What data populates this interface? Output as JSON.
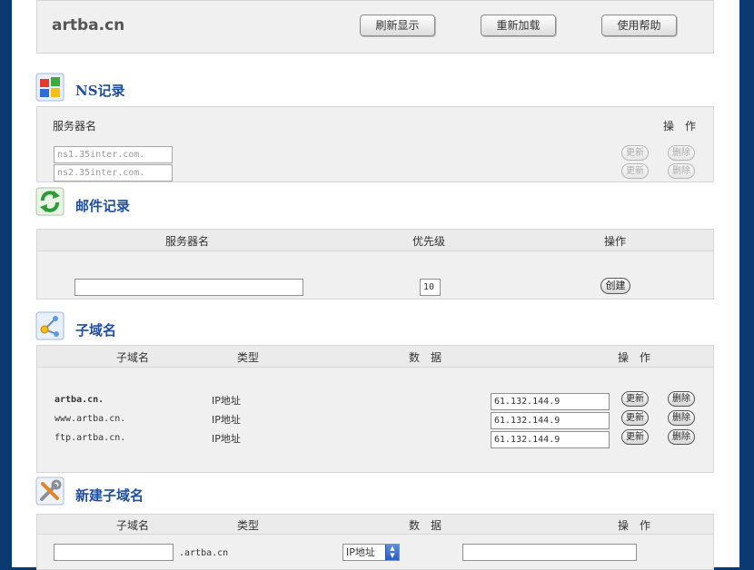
{
  "header": {
    "domain": "artba.cn",
    "refresh_label": "刷新显示",
    "reload_label": "重新加载",
    "help_label": "使用帮助"
  },
  "ns": {
    "title": "NS记录",
    "col_server": "服务器名",
    "col_action": "操　作",
    "rows": [
      {
        "value": "ns1.35inter.com.",
        "update": "更新",
        "delete": "删除"
      },
      {
        "value": "ns2.35inter.com.",
        "update": "更新",
        "delete": "删除"
      }
    ]
  },
  "mail": {
    "title": "邮件记录",
    "col_server": "服务器名",
    "col_priority": "优先级",
    "col_action": "操作",
    "server_value": "",
    "priority_value": "10",
    "create_label": "创建"
  },
  "subdomain": {
    "title": "子域名",
    "col_name": "子域名",
    "col_type": "类型",
    "col_data": "数　据",
    "col_action": "操　作",
    "rows": [
      {
        "name": "artba.cn.",
        "type": "IP地址",
        "data": "61.132.144.9",
        "update": "更新",
        "delete": "删除"
      },
      {
        "name": "www.artba.cn.",
        "type": "IP地址",
        "data": "61.132.144.9",
        "update": "更新",
        "delete": "删除"
      },
      {
        "name": "ftp.artba.cn.",
        "type": "IP地址",
        "data": "61.132.144.9",
        "update": "更新",
        "delete": "删除"
      }
    ]
  },
  "new_subdomain": {
    "title": "新建子域名",
    "col_name": "子域名",
    "col_type": "类型",
    "col_data": "数　据",
    "col_action": "操　作",
    "suffix": ".artba.cn",
    "type_selected": "IP地址",
    "name_value": "",
    "data_value": ""
  }
}
